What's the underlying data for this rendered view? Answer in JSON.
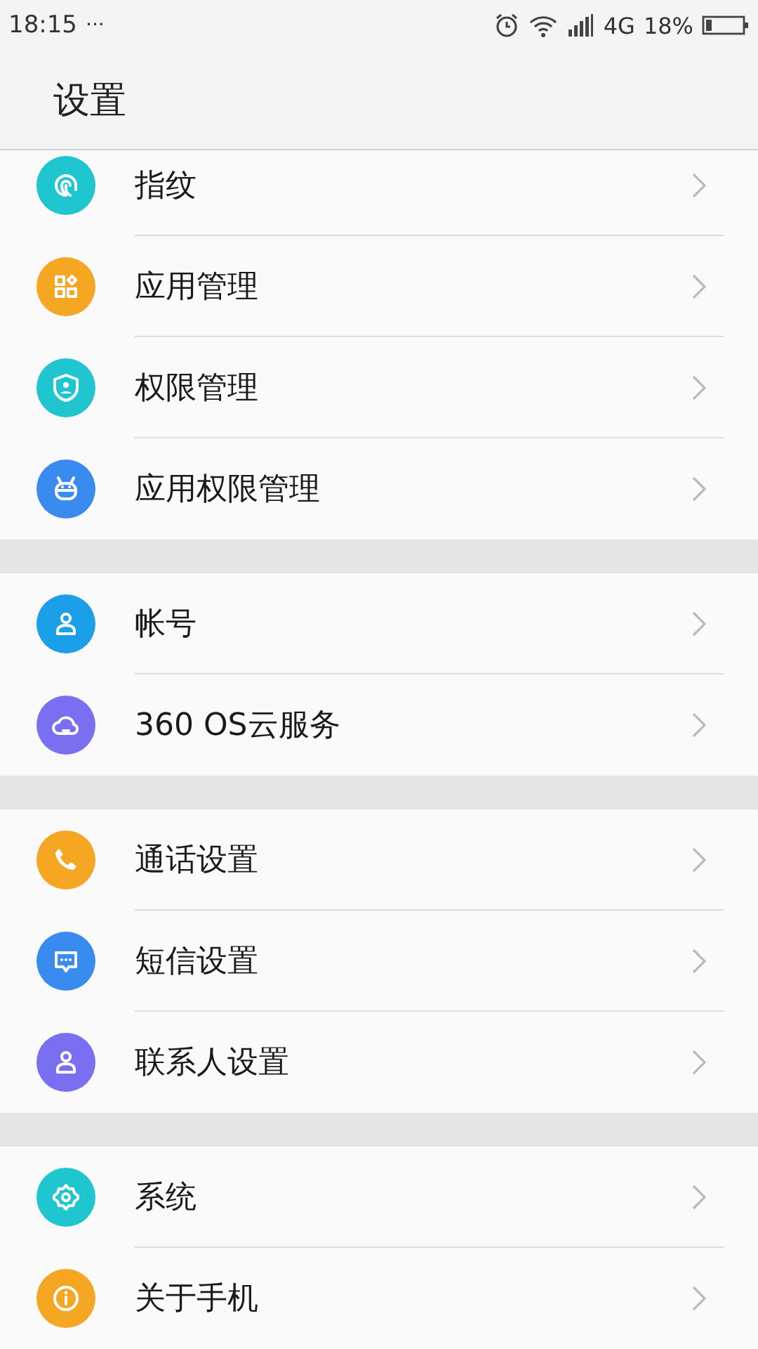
{
  "status_bar": {
    "time": "18:15",
    "more": "···",
    "network": "4G",
    "battery": "18%"
  },
  "header": {
    "title": "设置"
  },
  "groups": [
    {
      "items": [
        {
          "label": "指纹",
          "color": "#1fc6cf"
        },
        {
          "label": "应用管理",
          "color": "#f5a623"
        },
        {
          "label": "权限管理",
          "color": "#1fc6cf"
        },
        {
          "label": "应用权限管理",
          "color": "#3a8bef"
        }
      ]
    },
    {
      "items": [
        {
          "label": "帐号",
          "color": "#1a9fe8"
        },
        {
          "label": "360 OS云服务",
          "color": "#7a6ff0"
        }
      ]
    },
    {
      "items": [
        {
          "label": "通话设置",
          "color": "#f5a623"
        },
        {
          "label": "短信设置",
          "color": "#3a8bef"
        },
        {
          "label": "联系人设置",
          "color": "#7a6ff0"
        }
      ]
    },
    {
      "items": [
        {
          "label": "系统",
          "color": "#1fc6cf"
        },
        {
          "label": "关于手机",
          "color": "#f5a623"
        }
      ]
    }
  ]
}
